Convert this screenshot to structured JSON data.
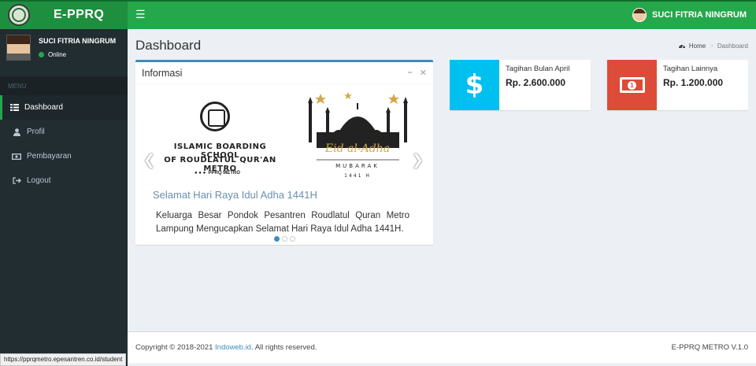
{
  "app": {
    "title": "E-PPRQ"
  },
  "header": {
    "user_name": "SUCI FITRIA NINGRUM",
    "menu_icon": "hamburger-icon"
  },
  "sidebar": {
    "user_name": "SUCI FITRIA NINGRUM",
    "status": "Online",
    "menu_header": "MENU",
    "items": [
      {
        "label": "Dashboard",
        "icon": "grid-icon",
        "active": true
      },
      {
        "label": "Profil",
        "icon": "user-icon"
      },
      {
        "label": "Pembayaran",
        "icon": "money-icon"
      },
      {
        "label": "Logout",
        "icon": "sign-out-icon"
      }
    ]
  },
  "page": {
    "title": "Dashboard",
    "breadcrumb": [
      "Home",
      "Dashboard"
    ]
  },
  "info_box": {
    "title": "Informasi",
    "slide": {
      "image_lines": [
        "ISLAMIC BOARDING SCHOOL",
        "OF ROUDLATUL QUR'AN METRO"
      ],
      "image_social": "PPRQ METRO",
      "greeting_script": "Eid al-Adha",
      "greeting_sub": "MUBARAK",
      "greeting_year": "1441 H",
      "caption": "Selamat Hari Raya Idul Adha 1441H",
      "text": "Keluarga Besar Pondok Pesantren Roudlatul Quran Metro Lampung Mengucapkan Selamat Hari Raya Idul Adha 1441H."
    },
    "slides_total": 3,
    "active_slide": 1
  },
  "stats": [
    {
      "label": "Tagihan Bulan April",
      "value": "Rp. 2.600.000",
      "color": "#00c0ef",
      "icon": "dollar-icon"
    },
    {
      "label": "Tagihan Lainnya",
      "value": "Rp. 1.200.000",
      "color": "#dd4b39",
      "icon": "money-bill-icon"
    }
  ],
  "footer": {
    "copyright_prefix": "Copyright © 2018-2021",
    "link": "Indoweb.id",
    "copyright_suffix": ". All rights reserved.",
    "version": "E-PPRQ METRO V.1.0"
  },
  "status_url": "https://pprqmetro.epesantren.co.id/student",
  "colors": {
    "header_green": "#25a74b",
    "logo_green": "#1e8f3e",
    "sidebar": "#222d32",
    "box_blue": "#3c8dbc"
  }
}
